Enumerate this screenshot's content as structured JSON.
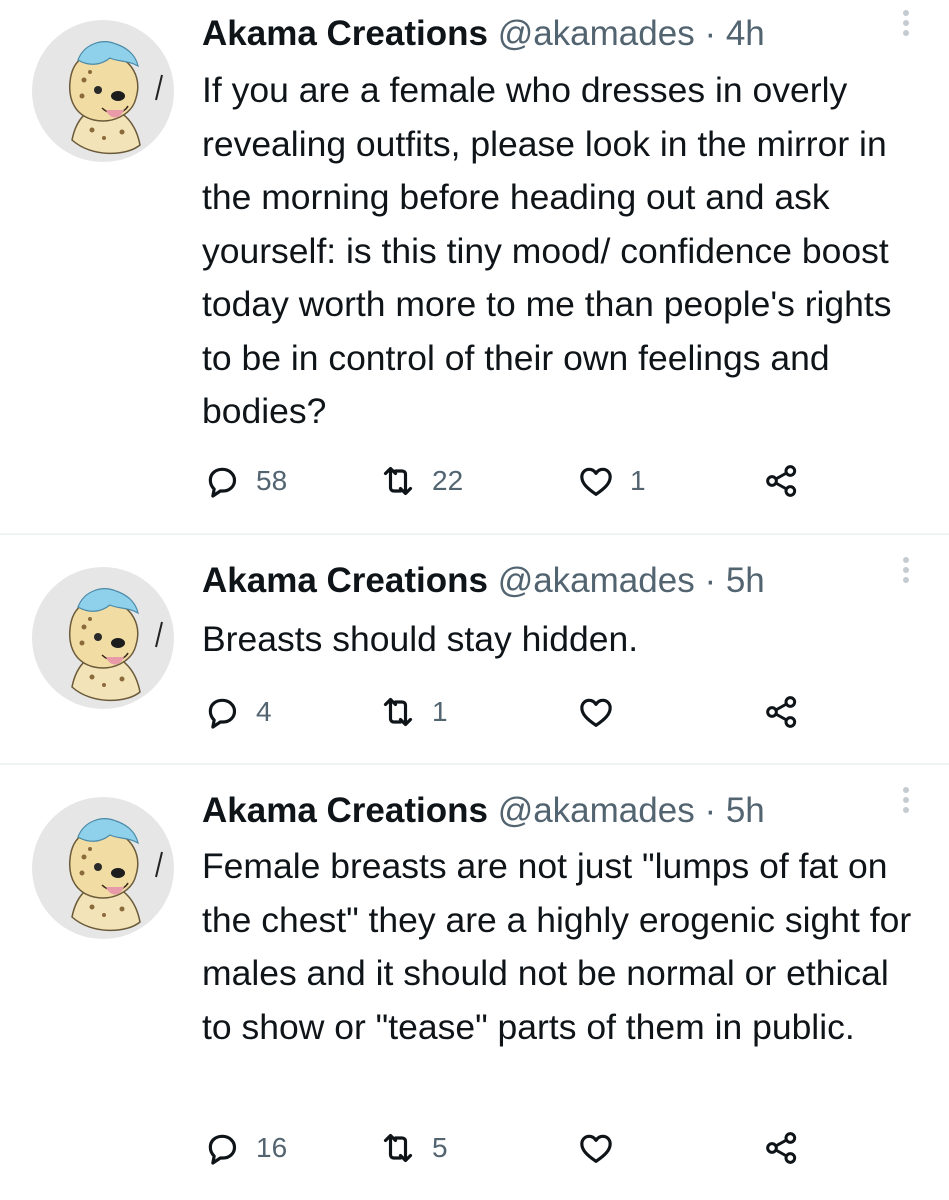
{
  "tweets": [
    {
      "author": "Akama Creations",
      "handle": "@akamades",
      "time": "· 4h",
      "text": "If you are a female who dresses in overly revealing outfits, please look in the mirror in the morning before heading out and ask yourself: is this tiny mood/ confidence boost today worth more to me than people's rights to be in control of their own feelings and bodies?",
      "replies": "58",
      "retweets": "22",
      "likes": "1"
    },
    {
      "author": "Akama Creations",
      "handle": "@akamades",
      "time": "· 5h",
      "text": "Breasts should stay hidden.",
      "replies": "4",
      "retweets": "1",
      "likes": ""
    },
    {
      "author": "Akama Creations",
      "handle": "@akamades",
      "time": "· 5h",
      "text": "Female breasts are not just \"lumps of fat on the chest\" they are a highly erogenic sight for males and it should not be normal or ethical to show or \"tease\" parts of them in public.",
      "replies": "16",
      "retweets": "5",
      "likes": ""
    }
  ],
  "icons": {
    "reply": "reply-icon",
    "retweet": "retweet-icon",
    "like": "heart-icon",
    "share": "share-icon",
    "more": "more-options-icon"
  },
  "colors": {
    "text": "#0f1419",
    "muted": "#536471",
    "divider": "#eff3f4",
    "avatar_bg": "#e6e6e6",
    "hair": "#8fd0ea"
  }
}
